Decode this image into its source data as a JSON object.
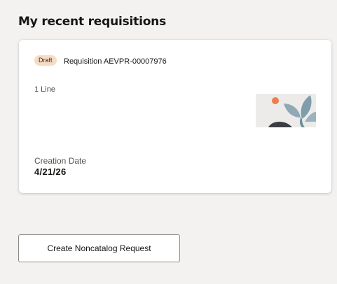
{
  "section": {
    "title": "My recent requisitions"
  },
  "requisition_card": {
    "status_badge": "Draft",
    "name": "Requisition AEVPR-00007976",
    "lines": "1 Line",
    "creation_date_label": "Creation Date",
    "creation_date_value": "4/21/26",
    "thumbnail_icon": "botanical-leaves-thumbnail"
  },
  "actions": {
    "create_noncatalog_label": "Create Noncatalog Request"
  },
  "colors": {
    "page_background": "#f3f2f1",
    "badge_background": "#f6dcc3",
    "thumbnail_orange": "#f07c4a",
    "thumbnail_leaf": "#8ea8b5",
    "thumbnail_dark": "#3a3d42"
  }
}
